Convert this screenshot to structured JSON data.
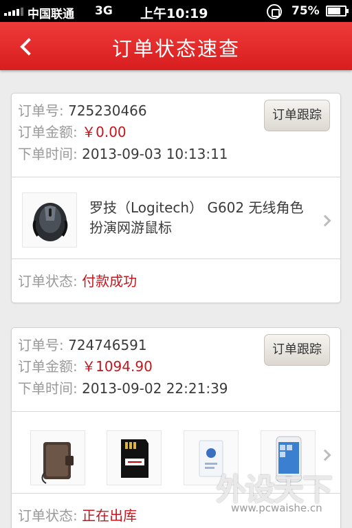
{
  "status_bar": {
    "carrier": "中国联通",
    "network": "3G",
    "time": "上午10:19",
    "battery": "75%",
    "battery_level": 0.75
  },
  "header": {
    "title": "订单状态速查",
    "back_icon": "chevron-left-icon"
  },
  "labels": {
    "order_no": "订单号:",
    "amount": "订单金额:",
    "order_time": "下单时间:",
    "status": "订单状态:",
    "track_button": "订单跟踪"
  },
  "orders": [
    {
      "order_no": "725230466",
      "amount": "￥0.00",
      "order_time": "2013-09-03 10:13:11",
      "product_name": "罗技（Logitech） G602 无线角色扮演网游鼠标",
      "product_images": [
        "gaming-mouse-image"
      ],
      "status": "付款成功"
    },
    {
      "order_no": "724746591",
      "amount": "￥1094.90",
      "order_time": "2013-09-02 22:21:39",
      "product_images": [
        "phone-case-image",
        "sd-card-image",
        "accessory-box-image",
        "smartphone-image"
      ],
      "status": "正在出库"
    }
  ],
  "watermark": {
    "brand": "外设天下",
    "url": "www.pcwaishe.cn"
  }
}
